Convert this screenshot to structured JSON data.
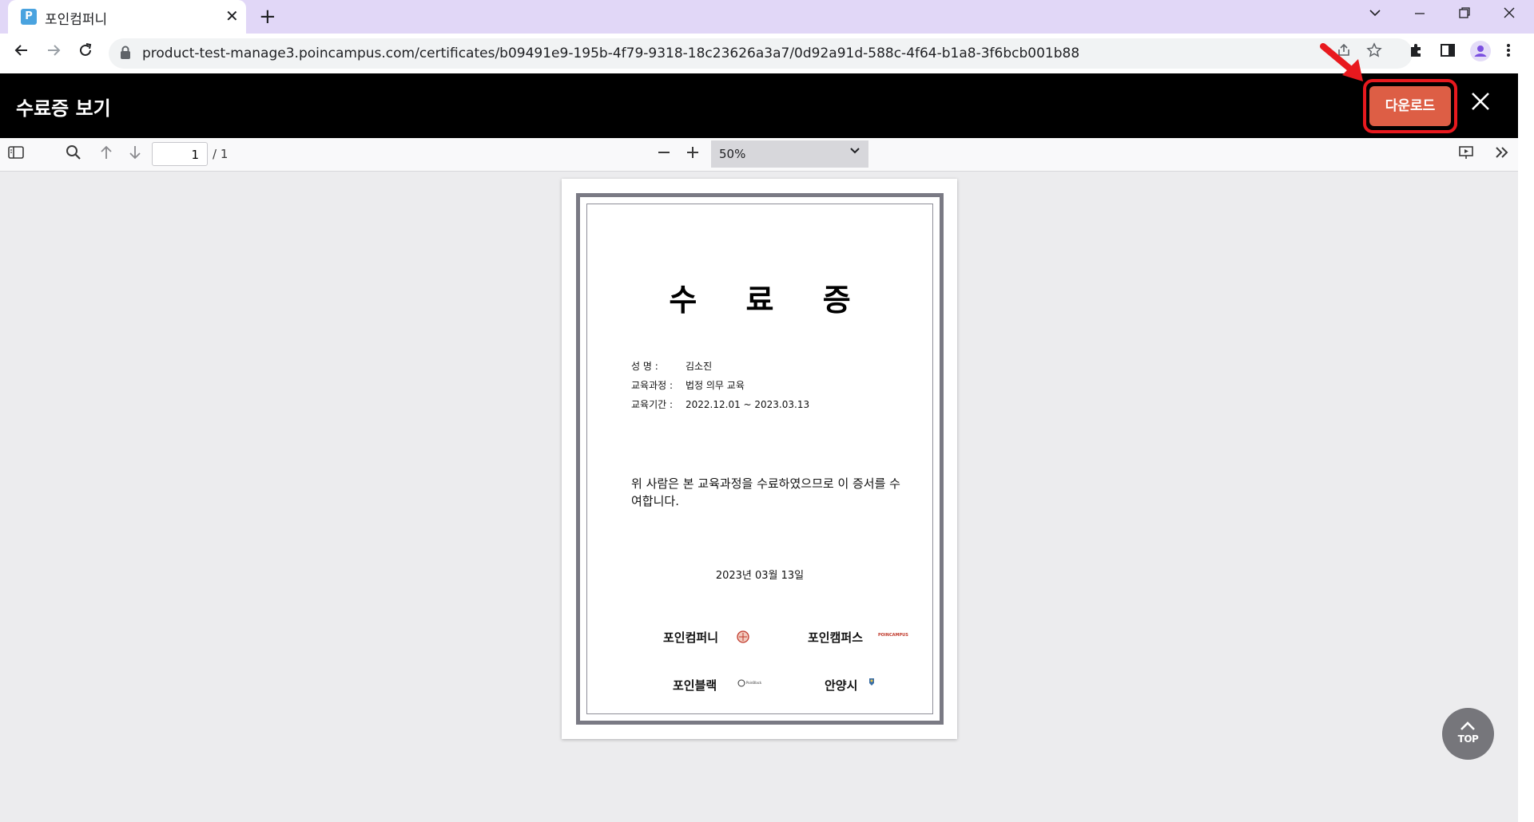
{
  "browser": {
    "tab": {
      "title": "포인컴퍼니",
      "favicon_letter": "P",
      "close_glyph": "✕"
    },
    "new_tab_glyph": "+",
    "url": "product-test-manage3.poincampus.com/certificates/b09491e9-195b-4f79-9318-18c23626a3a7/0d92a91d-588c-4f64-b1a8-3f6bcb001b88",
    "colors": {
      "tabstrip": "#e1d7f7",
      "profile": "#7b4fe0"
    }
  },
  "modal": {
    "title": "수료증 보기",
    "download_label": "다운로드",
    "colors": {
      "download": "#dd5e45",
      "highlight": "#e8191e"
    }
  },
  "pdf_toolbar": {
    "page_current": "1",
    "page_total": "/ 1",
    "zoom": "50%"
  },
  "certificate": {
    "title": "수 료 증",
    "fields": [
      {
        "label": "성      명 :",
        "value": "김소진"
      },
      {
        "label": "교육과정 :",
        "value": "법정 의무 교육"
      },
      {
        "label": "교육기간 :",
        "value": "2022.12.01 ~ 2023.03.13"
      }
    ],
    "body": "위 사람은 본 교육과정을 수료하였으므로 이 증서를 수여합니다.",
    "date": "2023년 03월 13일",
    "signatories": [
      "포인컴퍼니",
      "포인캠퍼스",
      "포인블랙",
      "안양시"
    ],
    "logo_text": {
      "poincampus": "POINCAMPUS",
      "poinblack": "PoinBlack"
    }
  },
  "top_button": {
    "label": "TOP"
  }
}
